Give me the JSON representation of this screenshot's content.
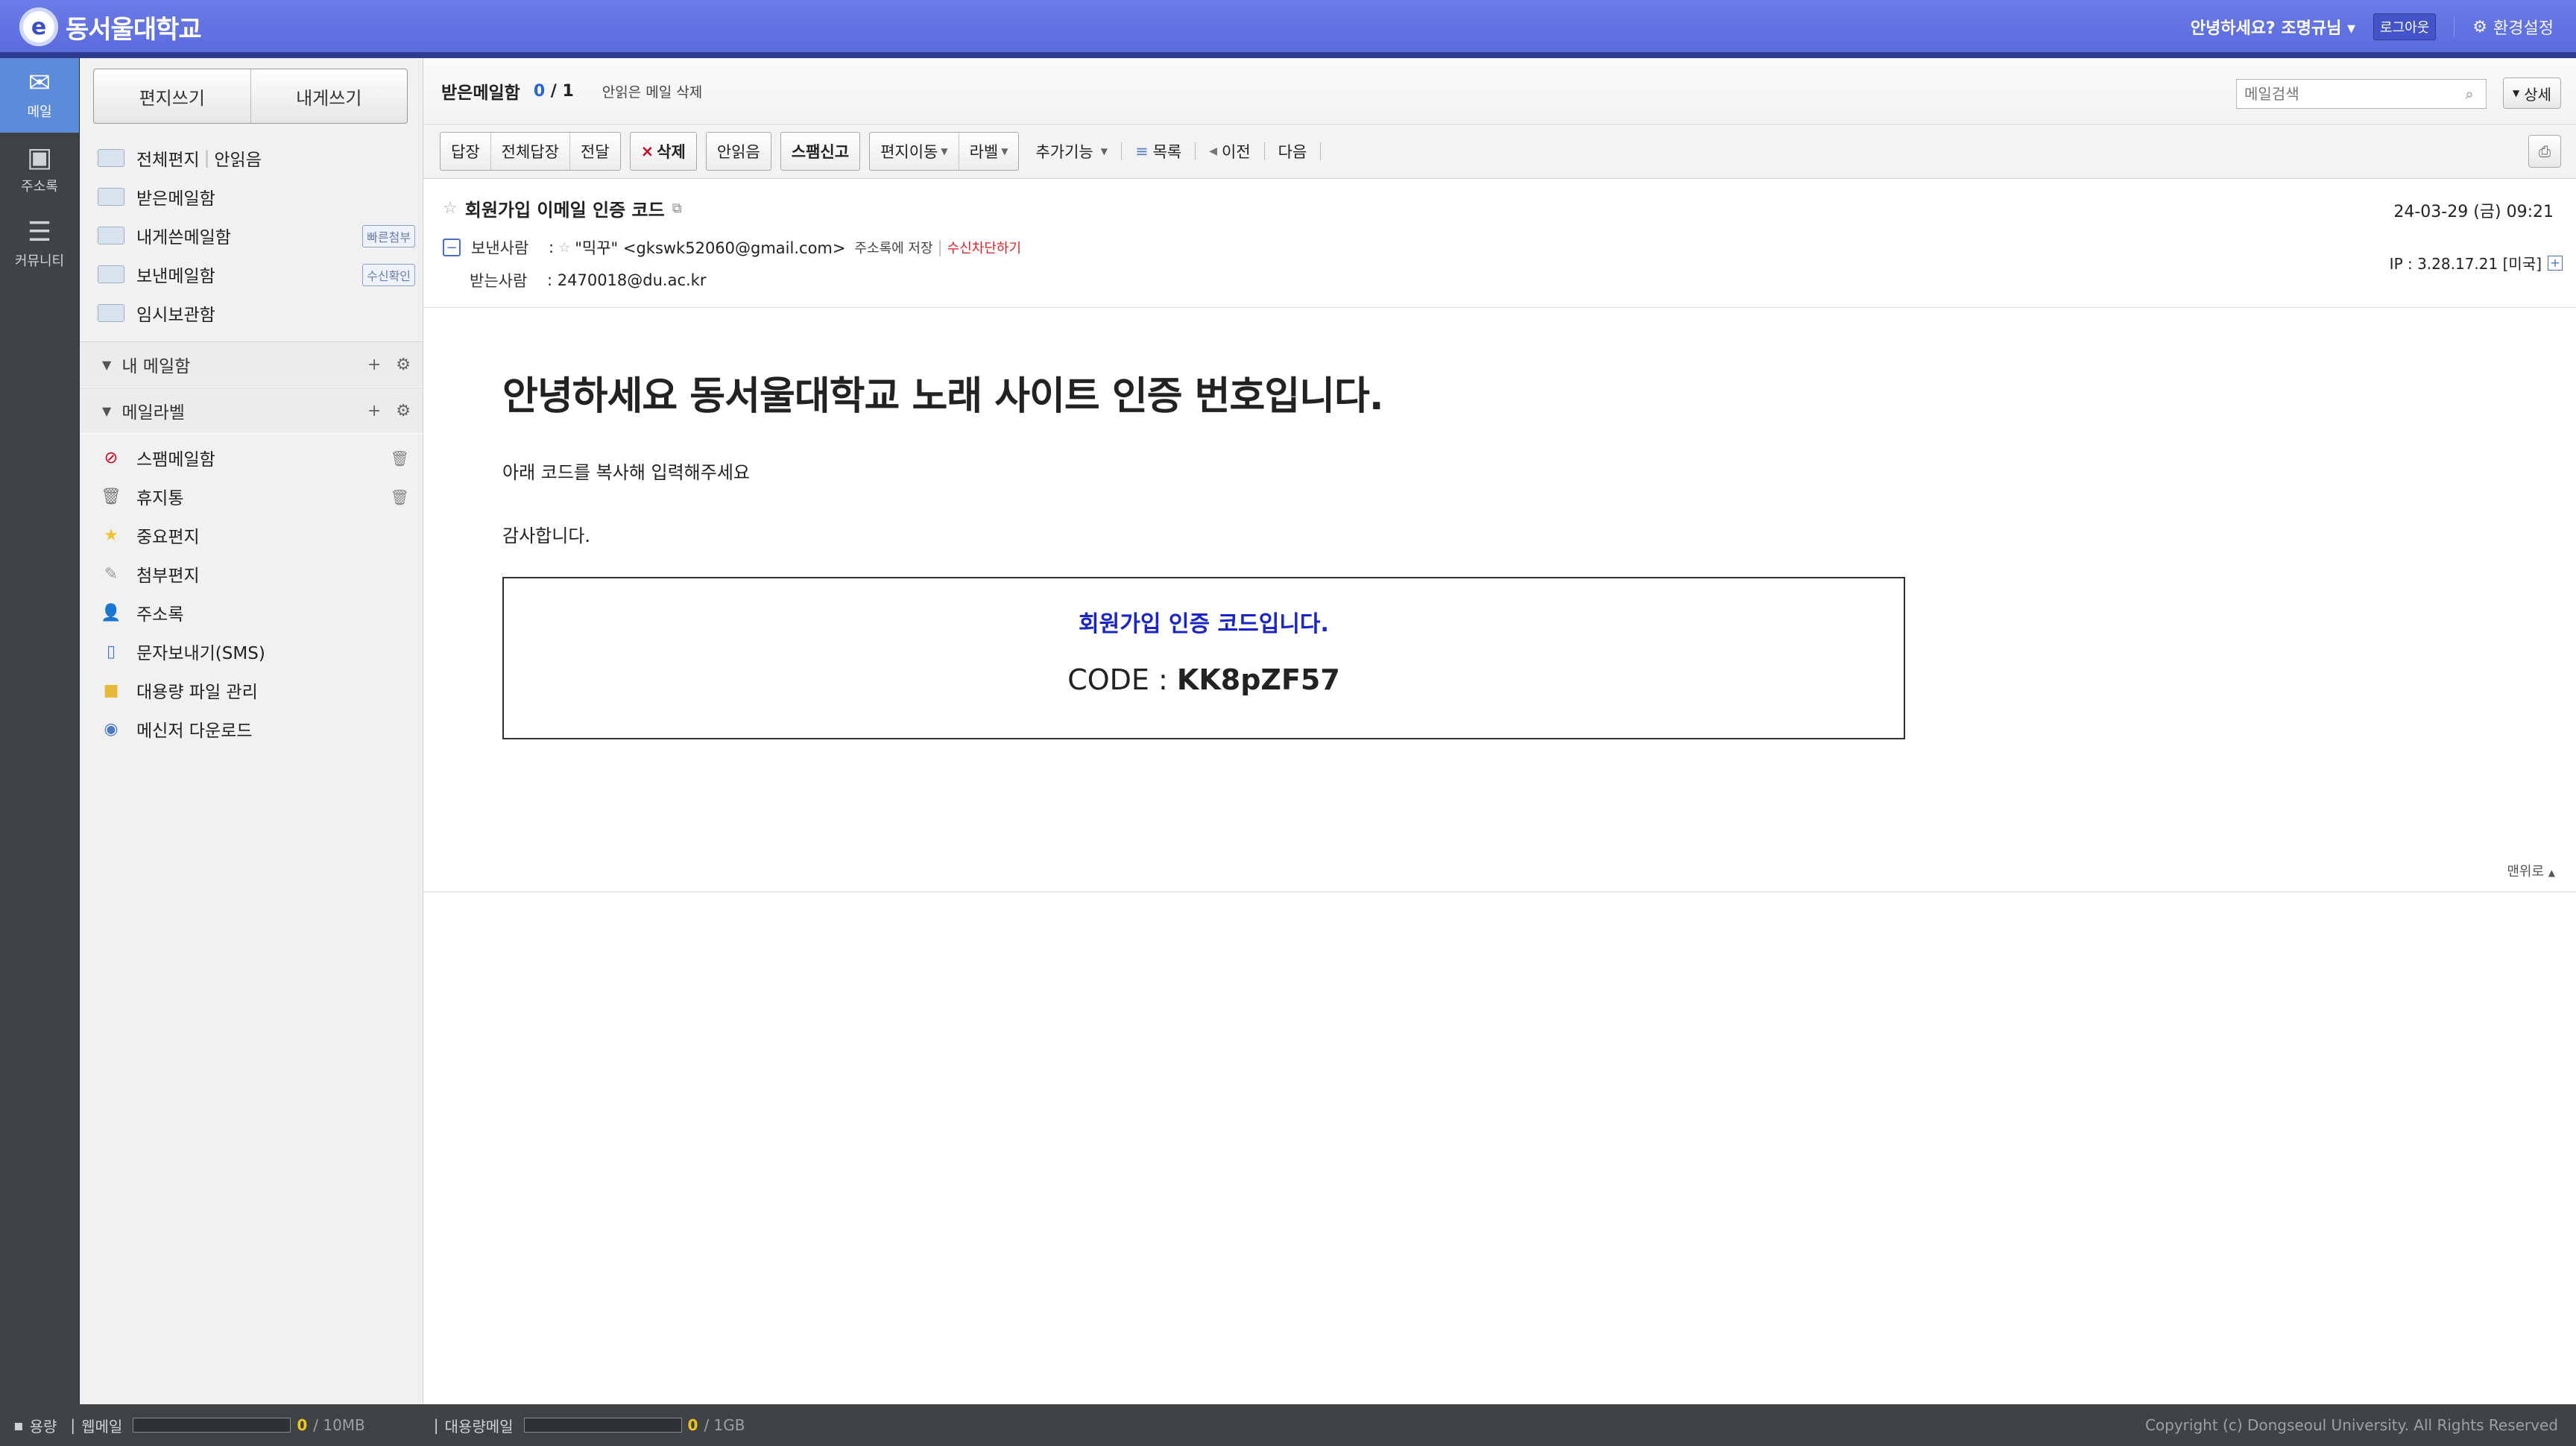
{
  "app": {
    "title": "동서울대학교"
  },
  "header": {
    "greeting": "안녕하세요? 조명규님",
    "logout": "로그아웃",
    "settings": "환경설정"
  },
  "rail": [
    {
      "label": "메일",
      "icon": "mail-icon"
    },
    {
      "label": "주소록",
      "icon": "contacts-icon"
    },
    {
      "label": "커뮤니티",
      "icon": "community-icon"
    }
  ],
  "compose": {
    "write": "편지쓰기",
    "self_write": "내게쓰기"
  },
  "folders": [
    {
      "label": "전체편지",
      "extra": "안읽음"
    },
    {
      "label": "받은메일함"
    },
    {
      "label": "내게쓴메일함",
      "tag": "빠른첨부"
    },
    {
      "label": "보낸메일함",
      "tag": "수신확인"
    },
    {
      "label": "임시보관함"
    }
  ],
  "sections": {
    "my_mailbox": "내 메일함",
    "labels": "메일라벨"
  },
  "extras": [
    {
      "label": "스팸메일함"
    },
    {
      "label": "휴지통"
    },
    {
      "label": "중요편지"
    },
    {
      "label": "첨부편지"
    },
    {
      "label": "주소록"
    },
    {
      "label": "문자보내기(SMS)"
    },
    {
      "label": "대용량 파일 관리"
    },
    {
      "label": "메신저 다운로드"
    }
  ],
  "listhead": {
    "title": "받은메일함",
    "unread": "0",
    "sep": " / ",
    "total": "1",
    "delete_read": "안읽은 메일 삭제",
    "search_placeholder": "메일검색",
    "detail": "상세"
  },
  "toolbar": {
    "reply": "답장",
    "reply_all": "전체답장",
    "forward": "전달",
    "delete": "삭제",
    "unread": "안읽음",
    "spam": "스팸신고",
    "move": "편지이동",
    "label": "라벨",
    "more": "추가기능",
    "list": "목록",
    "prev": "이전",
    "next": "다음"
  },
  "mail": {
    "subject": "회원가입 이메일 인증 코드",
    "date": "24-03-29 (금) 09:21",
    "from_label": "보낸사람",
    "from": "\"믹꾸\" <gkswk52060@gmail.com>",
    "save_address": "주소록에 저장",
    "block": "수신차단하기",
    "to_label": "받는사람",
    "to": ": 2470018@du.ac.kr",
    "ip": "IP : 3.28.17.21 [미국]"
  },
  "content": {
    "headline": "안녕하세요 동서울대학교 노래 사이트 인증 번호입니다.",
    "p1": "아래 코드를 복사해 입력해주세요",
    "p2": "감사합니다.",
    "code_title": "회원가입 인증 코드입니다.",
    "code_label": "CODE : ",
    "code_value": "KK8pZF57",
    "to_top": "맨위로"
  },
  "footer": {
    "quota_label": "용량",
    "webmail": "웹메일",
    "webmail_used": "0",
    "webmail_max": " / 10MB",
    "bigmail": "대용량메일",
    "bigmail_used": "0",
    "bigmail_max": " / 1GB",
    "copyright": "Copyright (c) Dongseoul University. All Rights Reserved"
  },
  "colors": {
    "topbar": "#5a6bde",
    "accent": "#2565d6",
    "spam_red": "#d0021b",
    "code_blue": "#1a25c8"
  }
}
